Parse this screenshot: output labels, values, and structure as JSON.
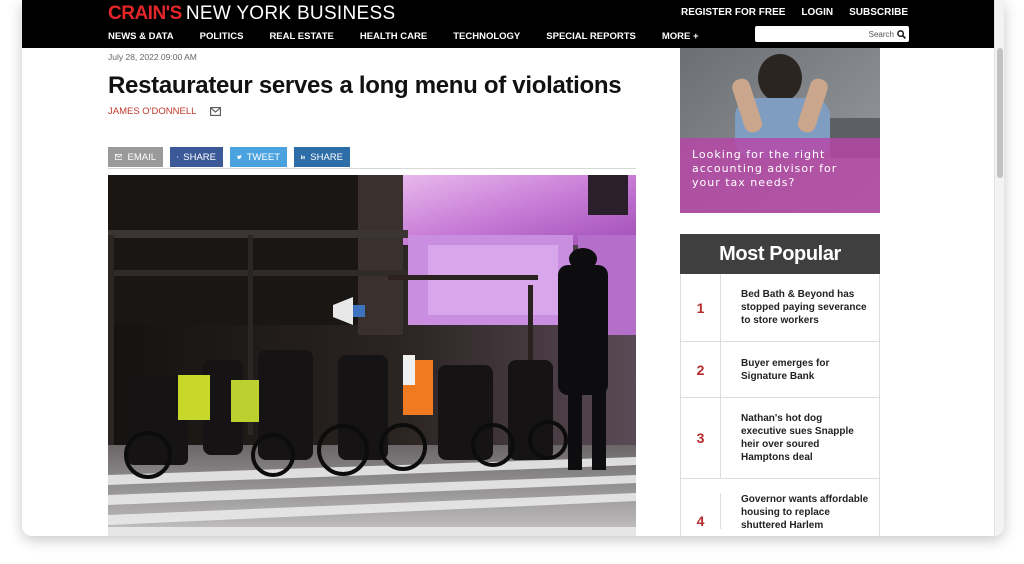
{
  "header": {
    "logo_brand": "CRAIN'S",
    "logo_name": "NEW YORK BUSINESS",
    "account_links": [
      "REGISTER FOR FREE",
      "LOGIN",
      "SUBSCRIBE"
    ],
    "nav": [
      "NEWS & DATA",
      "POLITICS",
      "REAL ESTATE",
      "HEALTH CARE",
      "TECHNOLOGY",
      "SPECIAL REPORTS",
      "MORE +"
    ],
    "search_placeholder": "Search"
  },
  "article": {
    "dateline": "July 28, 2022 09:00 AM",
    "headline": "Restaurateur serves a long menu of violations",
    "author": "JAMES O'DONNELL",
    "share": {
      "email": "EMAIL",
      "facebook": "SHARE",
      "twitter": "TWEET",
      "linkedin": "SHARE"
    }
  },
  "ad": {
    "text": "Looking for the right accounting advisor for your tax needs?"
  },
  "popular": {
    "title": "Most Popular",
    "items": [
      {
        "num": "1",
        "title": "Bed Bath & Beyond has stopped paying severance to store workers"
      },
      {
        "num": "2",
        "title": "Buyer emerges for Signature Bank"
      },
      {
        "num": "3",
        "title": "Nathan's hot dog executive sues Snapple heir over soured Hamptons deal"
      },
      {
        "num": "4",
        "title": "Governor wants affordable housing to replace shuttered Harlem"
      }
    ]
  },
  "colors": {
    "brand_red": "#e4262b",
    "facebook": "#3b5998",
    "twitter": "#4aa3df",
    "linkedin": "#2e6ea8",
    "popular_number": "#b52b2b"
  }
}
